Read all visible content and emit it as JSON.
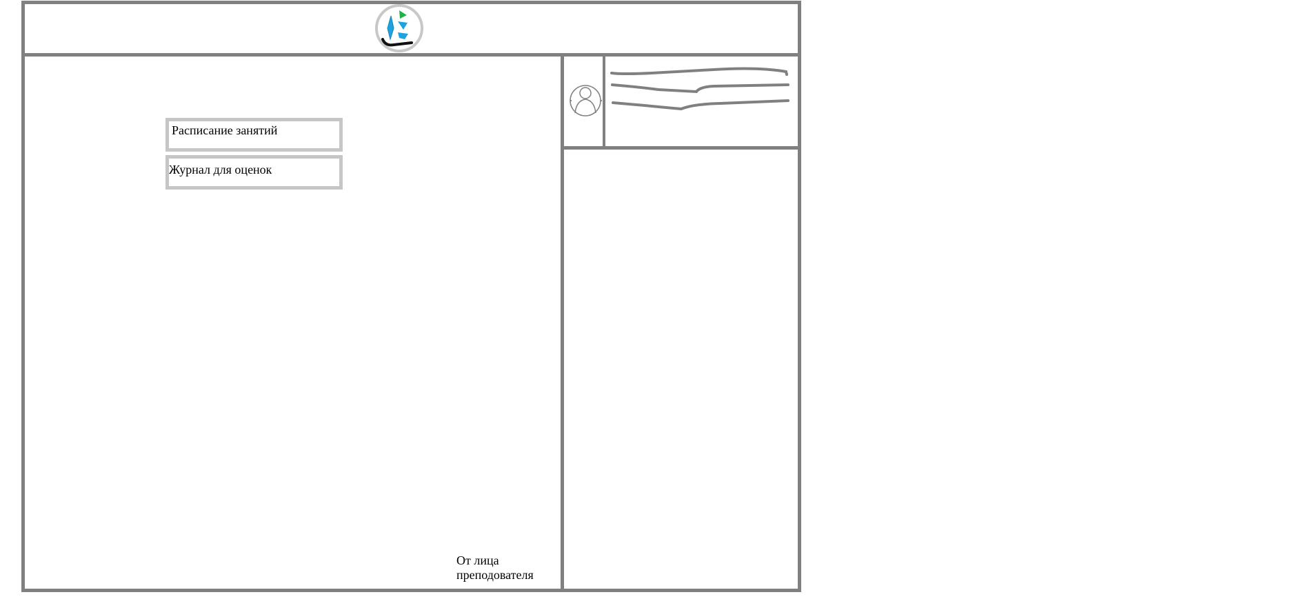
{
  "header": {
    "logo": "app-logo"
  },
  "menu": {
    "items": [
      {
        "label": "Расписание занятий"
      },
      {
        "label": "Журнал для оценок"
      }
    ]
  },
  "footer": {
    "note_line1": "От лица",
    "note_line2": "преподователя"
  },
  "profile": {
    "avatar": "avatar-icon",
    "name_placeholder": "scribble-lines"
  },
  "colors": {
    "frame": "#808080",
    "button_border": "#c6c6c6",
    "logo_blue": "#1fa3e0",
    "logo_green": "#22b04b"
  }
}
